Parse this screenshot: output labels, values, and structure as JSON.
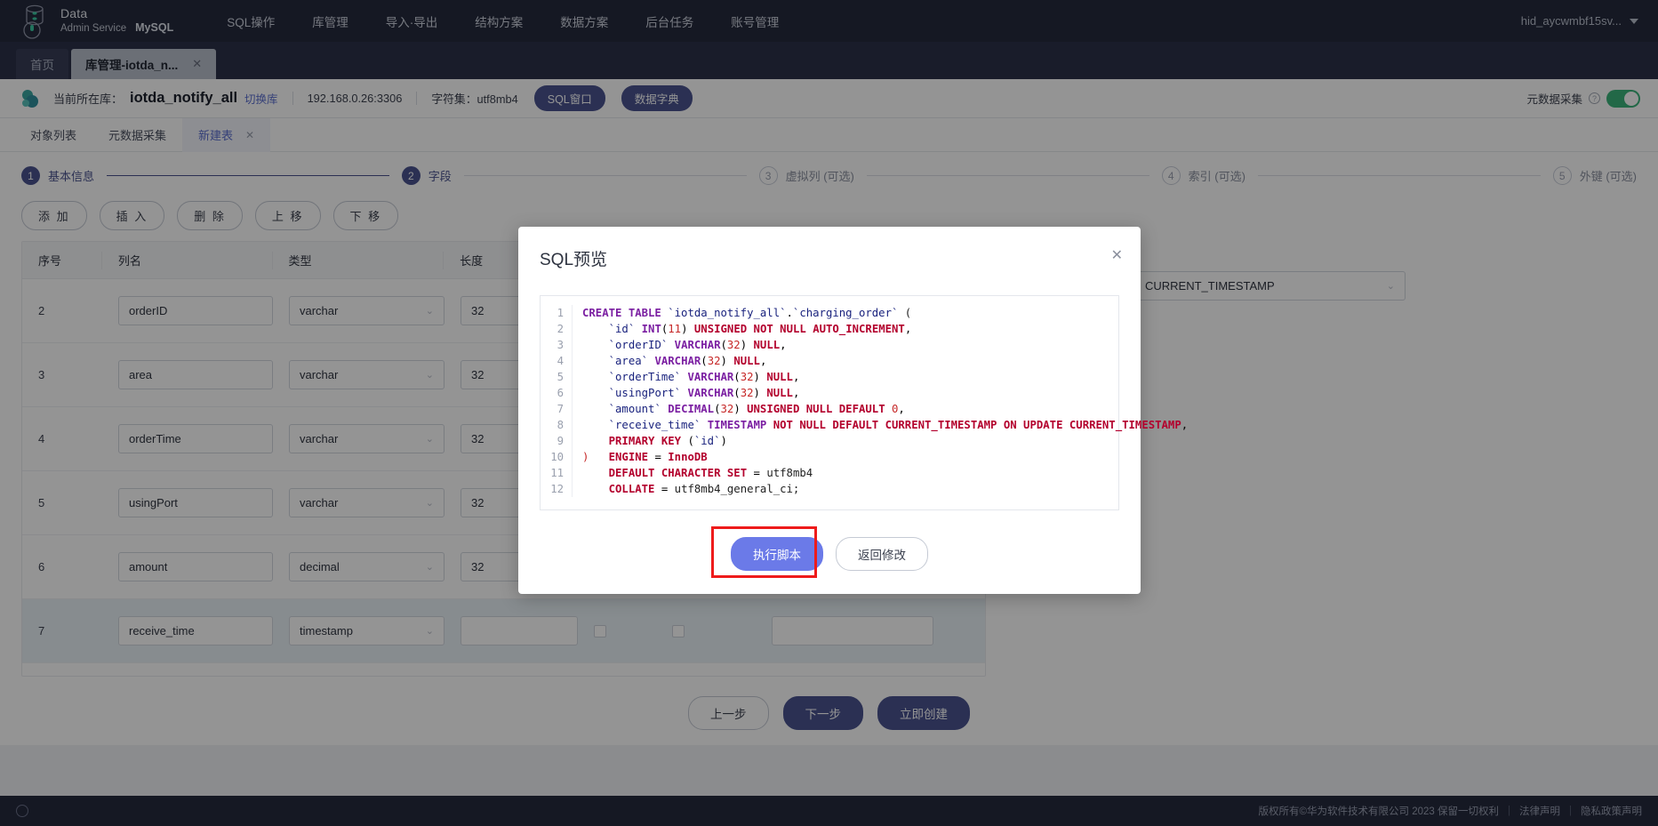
{
  "topnav": {
    "brand_line1": "Data",
    "brand_line2": "Admin Service",
    "brand_db": "MySQL",
    "items": [
      {
        "label": "SQL操作"
      },
      {
        "label": "库管理"
      },
      {
        "label": "导入·导出"
      },
      {
        "label": "结构方案"
      },
      {
        "label": "数据方案"
      },
      {
        "label": "后台任务"
      },
      {
        "label": "账号管理"
      }
    ],
    "username": "hid_aycwmbf15sv..."
  },
  "window_tabs": [
    {
      "label": "首页",
      "closable": false,
      "active": false
    },
    {
      "label": "库管理-iotda_n...",
      "closable": true,
      "active": true,
      "close": "✕"
    }
  ],
  "dbbar": {
    "current_label": "当前所在库：",
    "db_name": "iotda_notify_all",
    "switch_label": "切换库",
    "host": "192.168.0.26:3306",
    "charset": "字符集：utf8mb4",
    "sql_window_btn": "SQL窗口",
    "data_dict_btn": "数据字典",
    "meta_collect_label": "元数据采集",
    "help_icon": "?",
    "switch_on": true
  },
  "subtabs": [
    {
      "label": "对象列表",
      "active": false,
      "closable": false
    },
    {
      "label": "元数据采集",
      "active": false,
      "closable": false
    },
    {
      "label": "新建表",
      "active": true,
      "closable": true,
      "close": "✕"
    }
  ],
  "stepper": [
    {
      "num": "1",
      "label": "基本信息",
      "state": "done"
    },
    {
      "num": "2",
      "label": "字段",
      "state": "current"
    },
    {
      "num": "3",
      "label": "虚拟列 (可选)",
      "state": "todo"
    },
    {
      "num": "4",
      "label": "索引 (可选)",
      "state": "todo"
    },
    {
      "num": "5",
      "label": "外键 (可选)",
      "state": "todo"
    }
  ],
  "toolbar": [
    {
      "label": "添 加"
    },
    {
      "label": "插 入"
    },
    {
      "label": "删 除"
    },
    {
      "label": "上 移"
    },
    {
      "label": "下 移"
    }
  ],
  "table": {
    "columns": [
      "序号",
      "列名",
      "类型",
      "长度"
    ],
    "hidden_column_value": "CURRENT_TIMESTAMP",
    "rows": [
      {
        "idx": "2",
        "name": "orderID",
        "type": "varchar",
        "length": "32",
        "selected": false
      },
      {
        "idx": "3",
        "name": "area",
        "type": "varchar",
        "length": "32",
        "selected": false
      },
      {
        "idx": "4",
        "name": "orderTime",
        "type": "varchar",
        "length": "32",
        "selected": false
      },
      {
        "idx": "5",
        "name": "usingPort",
        "type": "varchar",
        "length": "32",
        "selected": false
      },
      {
        "idx": "6",
        "name": "amount",
        "type": "decimal",
        "length": "32",
        "selected": false
      },
      {
        "idx": "7",
        "name": "receive_time",
        "type": "timestamp",
        "length": "",
        "selected": true
      }
    ]
  },
  "page_buttons": [
    {
      "label": "上一步",
      "style": "ghost"
    },
    {
      "label": "下一步",
      "style": "primary"
    },
    {
      "label": "立即创建",
      "style": "primary"
    }
  ],
  "modal": {
    "title": "SQL预览",
    "close": "✕",
    "sql_lines": [
      {
        "n": "1",
        "text": "CREATE TABLE `iotda_notify_all`.`charging_order` ("
      },
      {
        "n": "2",
        "text": "    `id` INT(11) UNSIGNED NOT NULL AUTO_INCREMENT,"
      },
      {
        "n": "3",
        "text": "    `orderID` VARCHAR(32) NULL,"
      },
      {
        "n": "4",
        "text": "    `area` VARCHAR(32) NULL,"
      },
      {
        "n": "5",
        "text": "    `orderTime` VARCHAR(32) NULL,"
      },
      {
        "n": "6",
        "text": "    `usingPort` VARCHAR(32) NULL,"
      },
      {
        "n": "7",
        "text": "    `amount` DECIMAL(32) UNSIGNED NULL DEFAULT 0,"
      },
      {
        "n": "8",
        "text": "    `receive_time` TIMESTAMP NOT NULL DEFAULT CURRENT_TIMESTAMP ON UPDATE CURRENT_TIMESTAMP,"
      },
      {
        "n": "9",
        "text": "    PRIMARY KEY (`id`)"
      },
      {
        "n": "10",
        "text": ")   ENGINE = InnoDB"
      },
      {
        "n": "11",
        "text": "    DEFAULT CHARACTER SET = utf8mb4"
      },
      {
        "n": "12",
        "text": "    COLLATE = utf8mb4_general_ci;"
      }
    ],
    "execute_btn": "执行脚本",
    "back_btn": "返回修改"
  },
  "footer": {
    "copyright": "版权所有©华为软件技术有限公司 2023 保留一切权利",
    "sep": "|",
    "legal": "法律声明",
    "privacy": "隐私政策声明"
  },
  "colors": {
    "nav_bg": "#252a3d",
    "accent": "#4a5490",
    "primary_blue": "#6b7ae8",
    "link": "#5b6ecf",
    "highlight_red": "#ee1b1b",
    "switch_on": "#3cb37a"
  }
}
